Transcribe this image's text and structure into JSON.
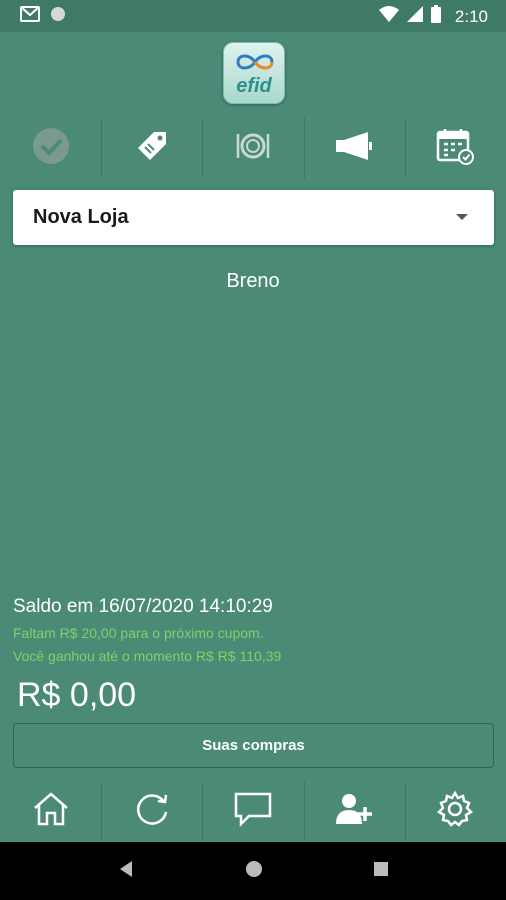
{
  "status_bar": {
    "time": "2:10"
  },
  "logo": {
    "text": "efid"
  },
  "top_tabs": [
    {
      "icon": "check-circle-icon"
    },
    {
      "icon": "price-tag-icon"
    },
    {
      "icon": "plate-cutlery-icon"
    },
    {
      "icon": "megaphone-icon"
    },
    {
      "icon": "calendar-check-icon"
    }
  ],
  "store_select": {
    "value": "Nova Loja"
  },
  "user": {
    "name": "Breno"
  },
  "balance": {
    "title": "Saldo em 16/07/2020 14:10:29",
    "missing_text": "Faltam R$ 20,00 para o próximo cupom.",
    "earned_text": "Você ganhou até o momento R$ R$ 110,39",
    "value": "R$ 0,00"
  },
  "purchases_button": {
    "label": "Suas compras"
  },
  "bottom_nav": [
    {
      "icon": "home-icon"
    },
    {
      "icon": "refresh-icon"
    },
    {
      "icon": "chat-icon"
    },
    {
      "icon": "add-user-icon"
    },
    {
      "icon": "settings-icon"
    }
  ],
  "colors": {
    "background": "#4a8a76",
    "status_bar": "#3f7a67",
    "accent_green_text": "#7bd46b"
  }
}
